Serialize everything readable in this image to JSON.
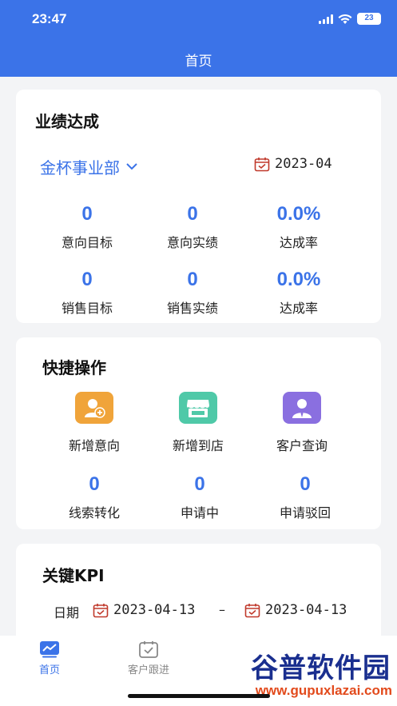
{
  "status_bar": {
    "time": "23:47",
    "battery": "23"
  },
  "header": {
    "title": "首页"
  },
  "performance": {
    "title": "业绩达成",
    "department": "金杯事业部",
    "month": "2023-04",
    "stats": [
      {
        "value": "0",
        "label": "意向目标"
      },
      {
        "value": "0",
        "label": "意向实绩"
      },
      {
        "value": "0.0%",
        "label": "达成率"
      },
      {
        "value": "0",
        "label": "销售目标"
      },
      {
        "value": "0",
        "label": "销售实绩"
      },
      {
        "value": "0.0%",
        "label": "达成率"
      }
    ]
  },
  "quick_actions": {
    "title": "快捷操作",
    "actions": [
      {
        "label": "新增意向",
        "icon": "add-user-icon",
        "color": "#f0a43a"
      },
      {
        "label": "新增到店",
        "icon": "store-icon",
        "color": "#4fc9a8"
      },
      {
        "label": "客户查询",
        "icon": "customer-icon",
        "color": "#8a6fe0"
      }
    ],
    "counts": [
      {
        "value": "0",
        "label": "线索转化"
      },
      {
        "value": "0",
        "label": "申请中"
      },
      {
        "value": "0",
        "label": "申请驳回"
      }
    ]
  },
  "kpi": {
    "title": "关键KPI",
    "date_label": "日期",
    "start_date": "2023-04-13",
    "separator": "–",
    "end_date": "2023-04-13"
  },
  "tabbar": {
    "tabs": [
      {
        "label": "首页",
        "icon": "chart-icon",
        "active": true
      },
      {
        "label": "客户跟进",
        "icon": "calendar-check-icon",
        "active": false
      }
    ]
  },
  "watermark": {
    "text": "谷普软件园",
    "url": "www.gupuxlazai.com"
  },
  "colors": {
    "primary": "#3b73e8",
    "background": "#f3f4f6"
  }
}
